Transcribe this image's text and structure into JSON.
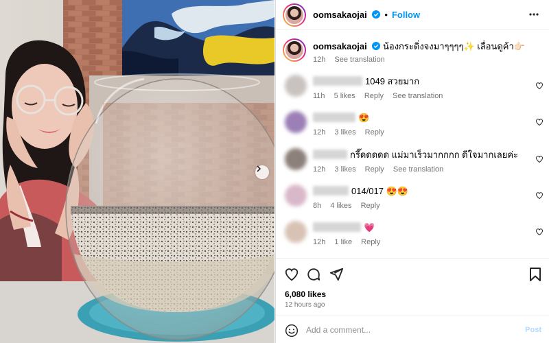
{
  "post": {
    "username": "oomsakaojai",
    "follow_label": "Follow",
    "dot": "•",
    "more_icon": "more-horizontal-icon"
  },
  "caption": {
    "username": "oomsakaojai",
    "text": "น้องกระดิ่งจงมาๆๆๆๆ✨ เลื่อนดูค้า👉🏻",
    "time": "12h",
    "see_translation": "See translation"
  },
  "comments": [
    {
      "text": "1049 สวยมาก",
      "time": "11h",
      "likes": "5 likes",
      "reply": "Reply",
      "see_translation": "See translation"
    },
    {
      "text": "😍",
      "time": "12h",
      "likes": "3 likes",
      "reply": "Reply"
    },
    {
      "text": "กรี๊ดดดดด แม่มาเร็วมากกกก ดีใจมากเลยค่ะ",
      "time": "12h",
      "likes": "3 likes",
      "reply": "Reply",
      "see_translation": "See translation"
    },
    {
      "text": "014/017 😍😍",
      "time": "8h",
      "likes": "4 likes",
      "reply": "Reply"
    },
    {
      "text": "💗",
      "time": "12h",
      "likes": "1 like",
      "reply": "Reply"
    }
  ],
  "footer": {
    "likes": "6,080 likes",
    "time_ago": "12 hours ago",
    "comment_placeholder": "Add a comment...",
    "post_label": "Post"
  },
  "colors": {
    "accent": "#0095f6",
    "muted": "#737373",
    "post_disabled": "#b3dbff"
  }
}
